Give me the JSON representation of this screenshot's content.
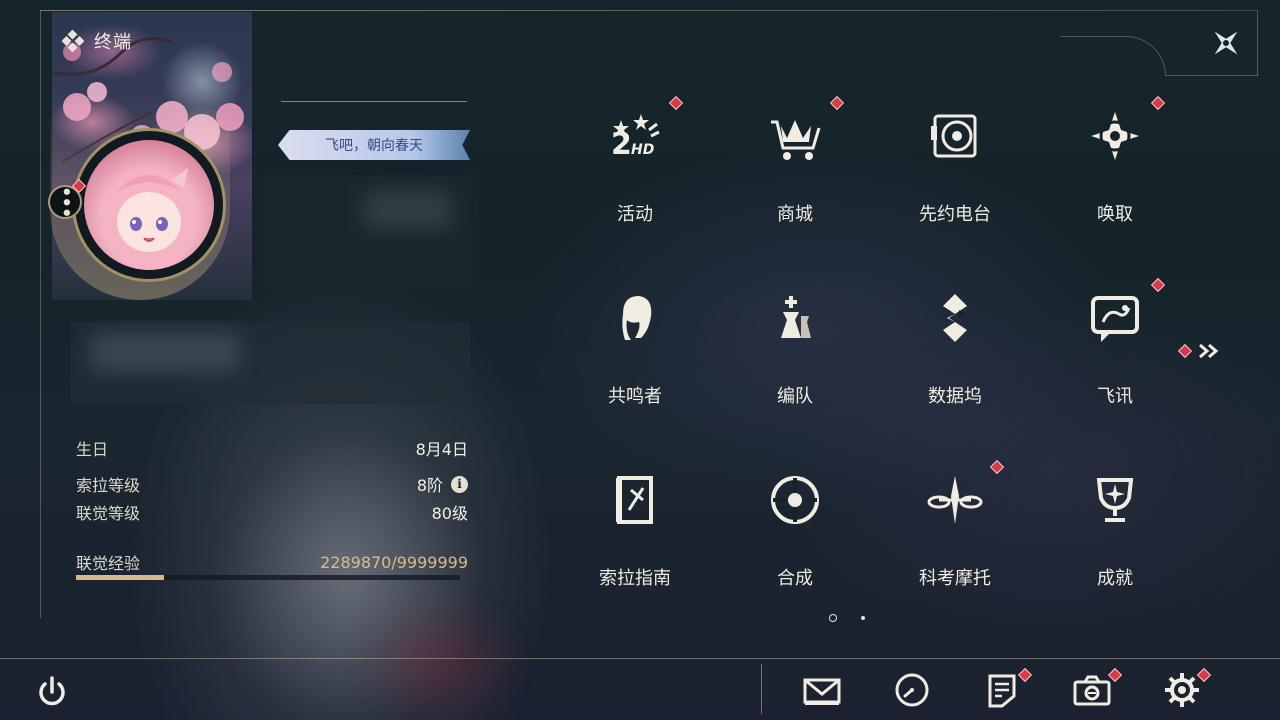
{
  "header": {
    "title": "终端",
    "logo_icon": "terminal-diamond-icon"
  },
  "profile": {
    "signature": "飞吧，朝向春天",
    "birthday_label": "生日",
    "birthday": "8月4日",
    "sola_level_label": "索拉等级",
    "sola_level": "8阶",
    "info_icon_text": "i",
    "union_level_label": "联觉等级",
    "union_level": "80级",
    "union_exp_label": "联觉经验",
    "union_exp": "2289870/9999999",
    "union_exp_fraction": 0.229
  },
  "menu": [
    {
      "label": "活动",
      "icon": "events-2hd-icon",
      "badge": true
    },
    {
      "label": "商城",
      "icon": "shop-crown-cart-icon",
      "badge": true
    },
    {
      "label": "先约电台",
      "icon": "radio-record-icon",
      "badge": false
    },
    {
      "label": "唤取",
      "icon": "convene-compass-icon",
      "badge": true
    },
    {
      "label": "共鸣者",
      "icon": "resonator-portrait-icon",
      "badge": false
    },
    {
      "label": "编队",
      "icon": "team-chess-icon",
      "badge": false
    },
    {
      "label": "数据坞",
      "icon": "data-bank-icon",
      "badge": false
    },
    {
      "label": "飞讯",
      "icon": "message-bubble-icon",
      "badge": true
    },
    {
      "label": "索拉指南",
      "icon": "guidebook-icon",
      "badge": false
    },
    {
      "label": "合成",
      "icon": "synthesis-orb-icon",
      "badge": false
    },
    {
      "label": "科考摩托",
      "icon": "motorcycle-icon",
      "badge": true
    },
    {
      "label": "成就",
      "icon": "achievement-trophy-icon",
      "badge": false
    }
  ],
  "pagination": {
    "current": 1,
    "total": 2
  },
  "bottom_bar": [
    {
      "name": "power",
      "icon": "power-icon",
      "badge": false
    },
    {
      "name": "mail",
      "icon": "mail-icon",
      "badge": false
    },
    {
      "name": "clock",
      "icon": "clock-icon",
      "badge": false
    },
    {
      "name": "notes",
      "icon": "notes-icon",
      "badge": true
    },
    {
      "name": "camera",
      "icon": "camera-icon",
      "badge": true
    },
    {
      "name": "settings",
      "icon": "settings-gear-icon",
      "badge": true
    }
  ],
  "colors": {
    "accent_gold": "#d9b786",
    "badge_red": "#d83a48",
    "text_light": "#f0ece2"
  }
}
